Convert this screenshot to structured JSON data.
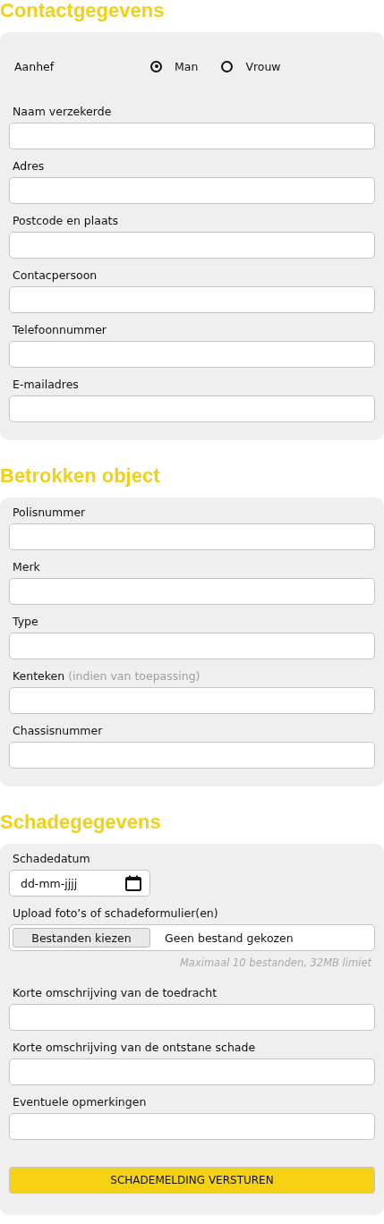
{
  "sections": [
    {
      "title": "Contactgegevens",
      "salutation": {
        "label": "Aanhef",
        "options": [
          {
            "label": "Man",
            "selected": true
          },
          {
            "label": "Vrouw",
            "selected": false
          }
        ]
      },
      "fields": [
        {
          "kind": "text",
          "label": "Naam verzekerde"
        },
        {
          "kind": "text",
          "label": "Adres"
        },
        {
          "kind": "text",
          "label": "Postcode en plaats"
        },
        {
          "kind": "text",
          "label": "Contacpersoon"
        },
        {
          "kind": "text",
          "label": "Telefoonnummer"
        },
        {
          "kind": "text",
          "label": "E-mailadres"
        }
      ]
    },
    {
      "title": "Betrokken object",
      "fields": [
        {
          "kind": "text",
          "label": "Polisnummer"
        },
        {
          "kind": "text",
          "label": "Merk"
        },
        {
          "kind": "text",
          "label": "Type"
        },
        {
          "kind": "text",
          "label": "Kenteken",
          "hint": "(indien van toepassing)"
        },
        {
          "kind": "text",
          "label": "Chassisnummer"
        }
      ]
    },
    {
      "title": "Schadegegevens",
      "fields": [
        {
          "kind": "date",
          "label": "Schadedatum",
          "placeholder": "dd-mm-jjjj"
        },
        {
          "kind": "file",
          "label": "Upload foto’s of schadeformulier(en)",
          "button": "Bestanden kiezen",
          "status": "Geen bestand gekozen",
          "note": "Maximaal 10 bestanden, 32MB limiet"
        },
        {
          "kind": "text",
          "label": "Korte omschrijving van de toedracht"
        },
        {
          "kind": "text",
          "label": "Korte omschrijving van de ontstane schade"
        },
        {
          "kind": "text",
          "label": "Eventuele opmerkingen"
        }
      ],
      "submit": "SCHADEMELDING VERSTUREN"
    }
  ]
}
